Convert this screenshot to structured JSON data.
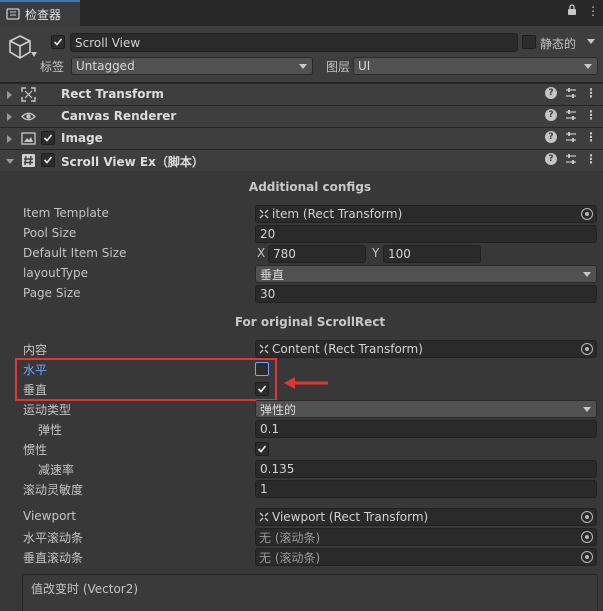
{
  "tab": {
    "title": "检查器"
  },
  "header": {
    "object_name": "Scroll View",
    "static_label": "静态的",
    "tag_label": "标签",
    "tag_value": "Untagged",
    "layer_label": "图层",
    "layer_value": "UI"
  },
  "components": [
    {
      "title": "Rect Transform"
    },
    {
      "title": "Canvas Renderer"
    },
    {
      "title": "Image"
    },
    {
      "title": "Scroll View Ex（脚本）"
    }
  ],
  "additional": {
    "section_title": "Additional configs",
    "item_template_label": "Item Template",
    "item_template_value": "item (Rect Transform)",
    "pool_size_label": "Pool Size",
    "pool_size_value": "20",
    "default_item_size_label": "Default Item Size",
    "x_label": "X",
    "x_value": "780",
    "y_label": "Y",
    "y_value": "100",
    "layout_type_label": "layoutType",
    "layout_type_value": "垂直",
    "page_size_label": "Page Size",
    "page_size_value": "30"
  },
  "scrollrect": {
    "section_title": "For original ScrollRect",
    "content_label": "内容",
    "content_value": "Content (Rect Transform)",
    "horizontal_label": "水平",
    "horizontal_checked": false,
    "vertical_label": "垂直",
    "vertical_checked": true,
    "movement_label": "运动类型",
    "movement_value": "弹性的",
    "elasticity_label": "弹性",
    "elasticity_value": "0.1",
    "inertia_label": "惯性",
    "inertia_checked": true,
    "deceleration_label": "减速率",
    "deceleration_value": "0.135",
    "sensitivity_label": "滚动灵敏度",
    "sensitivity_value": "1",
    "viewport_label": "Viewport",
    "viewport_value": "Viewport (Rect Transform)",
    "hscrollbar_label": "水平滚动条",
    "hscrollbar_value": "无 (滚动条)",
    "vscrollbar_label": "垂直滚动条",
    "vscrollbar_value": "无 (滚动条)"
  },
  "event": {
    "title": "值改变时 (Vector2)"
  },
  "colors": {
    "highlight": "#e03636",
    "focus_label": "#6fa8ff"
  }
}
